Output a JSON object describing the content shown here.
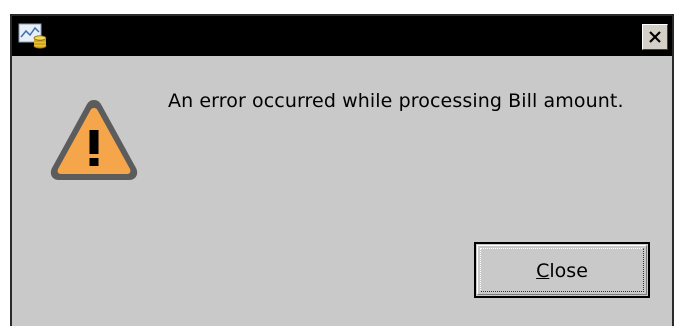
{
  "window": {
    "app_icon": "app-chart-coins-icon",
    "close_icon": "close-x-icon"
  },
  "dialog": {
    "icon": "warning-triangle-icon",
    "message": "An error occurred while processing Bill amount.",
    "close_button": {
      "mnemonic": "C",
      "rest": "lose"
    }
  },
  "colors": {
    "background": "#c9c9c9",
    "titlebar": "#000000",
    "warning_fill": "#f5a54a",
    "warning_border": "#5a5a5a"
  }
}
